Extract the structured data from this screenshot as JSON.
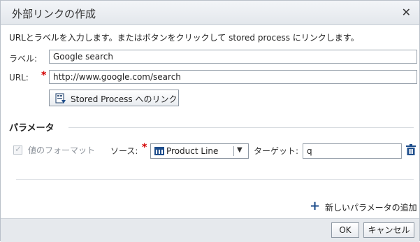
{
  "dialog": {
    "title": "外部リンクの作成",
    "close_icon": "close-icon"
  },
  "instruction": "URLとラベルを入力します。またはボタンをクリックして stored process にリンクします。",
  "label_field": {
    "label": "ラベル:",
    "value": "Google search"
  },
  "url_field": {
    "label": "URL:",
    "required_marker": "*",
    "value": "http://www.google.com/search"
  },
  "stored_process_button": {
    "label": "Stored Process へのリンク",
    "icon": "stored-process-icon"
  },
  "parameters": {
    "section_title": "パラメータ",
    "format_checkbox": {
      "label": "値のフォーマット",
      "checked": true,
      "disabled": true
    },
    "source": {
      "label": "ソース:",
      "required_marker": "*",
      "selected": "Product Line",
      "icon": "category-icon"
    },
    "target": {
      "label": "ターゲット:",
      "value": "q"
    },
    "delete_icon": "trash-icon"
  },
  "add_parameter": {
    "label": "新しいパラメータの追加",
    "icon": "plus-icon"
  },
  "footer": {
    "ok_label": "OK",
    "cancel_label": "キャンセル"
  },
  "colors": {
    "accent": "#1f4e8c",
    "required": "#d40000",
    "footer_bg": "#e6e9ed"
  }
}
